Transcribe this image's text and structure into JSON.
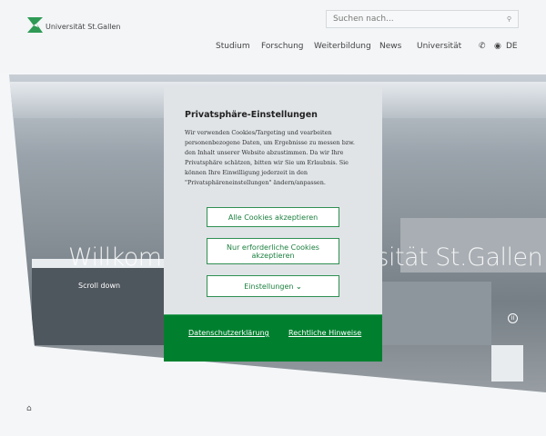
{
  "header": {
    "logo_text": "Universität St.Gallen",
    "search_placeholder": "Suchen nach...",
    "nav": [
      "Studium",
      "Forschung",
      "Weiterbildung",
      "News",
      "Universität"
    ],
    "language": "DE"
  },
  "hero": {
    "title_left": "Willkommen an der",
    "title_right": "Universität St.Gallen",
    "scroll": "Scroll down"
  },
  "modal": {
    "title": "Privatsphäre-Einstellungen",
    "text": "Wir verwenden Cookies/Targeting und vearbeiten personenbezogene Daten, um Ergebnisse zu messen bzw. den Inhalt unserer Website abzustimmen. Da wir Ihre Privatsphäre schätzen, bitten wir Sie um Erlaubnis. Sie können Ihre Einwilligung jederzeit in den \"Privatsphäreneinstellungen\" ändern/anpassen.",
    "accept_all": "Alle Cookies akzeptieren",
    "accept_required": "Nur erforderliche Cookies akzeptieren",
    "settings": "Einstellungen",
    "privacy_link": "Datenschutzerklärung",
    "legal_link": "Rechtliche Hinweise"
  },
  "colors": {
    "brand_green": "#00802f",
    "modal_bg": "#e0e4e7"
  }
}
